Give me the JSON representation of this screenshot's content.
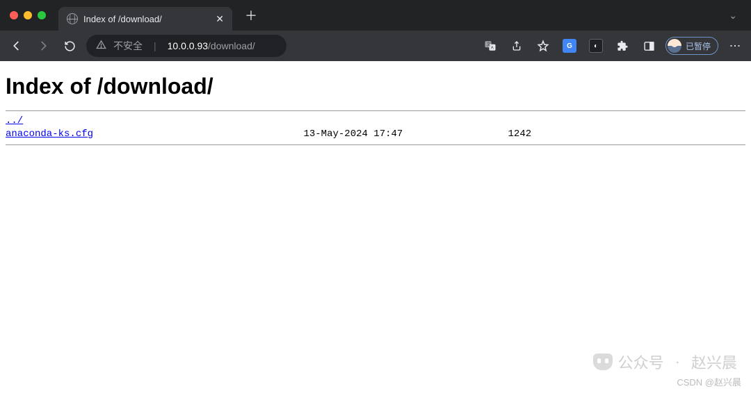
{
  "browser": {
    "tab_title": "Index of /download/",
    "address": {
      "security_label": "不安全",
      "host": "10.0.0.93",
      "path": "/download/"
    },
    "profile_label": "已暂停"
  },
  "page": {
    "heading": "Index of /download/",
    "entries": [
      {
        "name": "../",
        "date": "",
        "size": ""
      },
      {
        "name": "anaconda-ks.cfg",
        "date": "13-May-2024 17:47",
        "size": "1242"
      }
    ]
  },
  "watermark": {
    "line1_prefix": "公众号",
    "line1_name": "赵兴晨",
    "line2": "CSDN @赵兴晨"
  }
}
